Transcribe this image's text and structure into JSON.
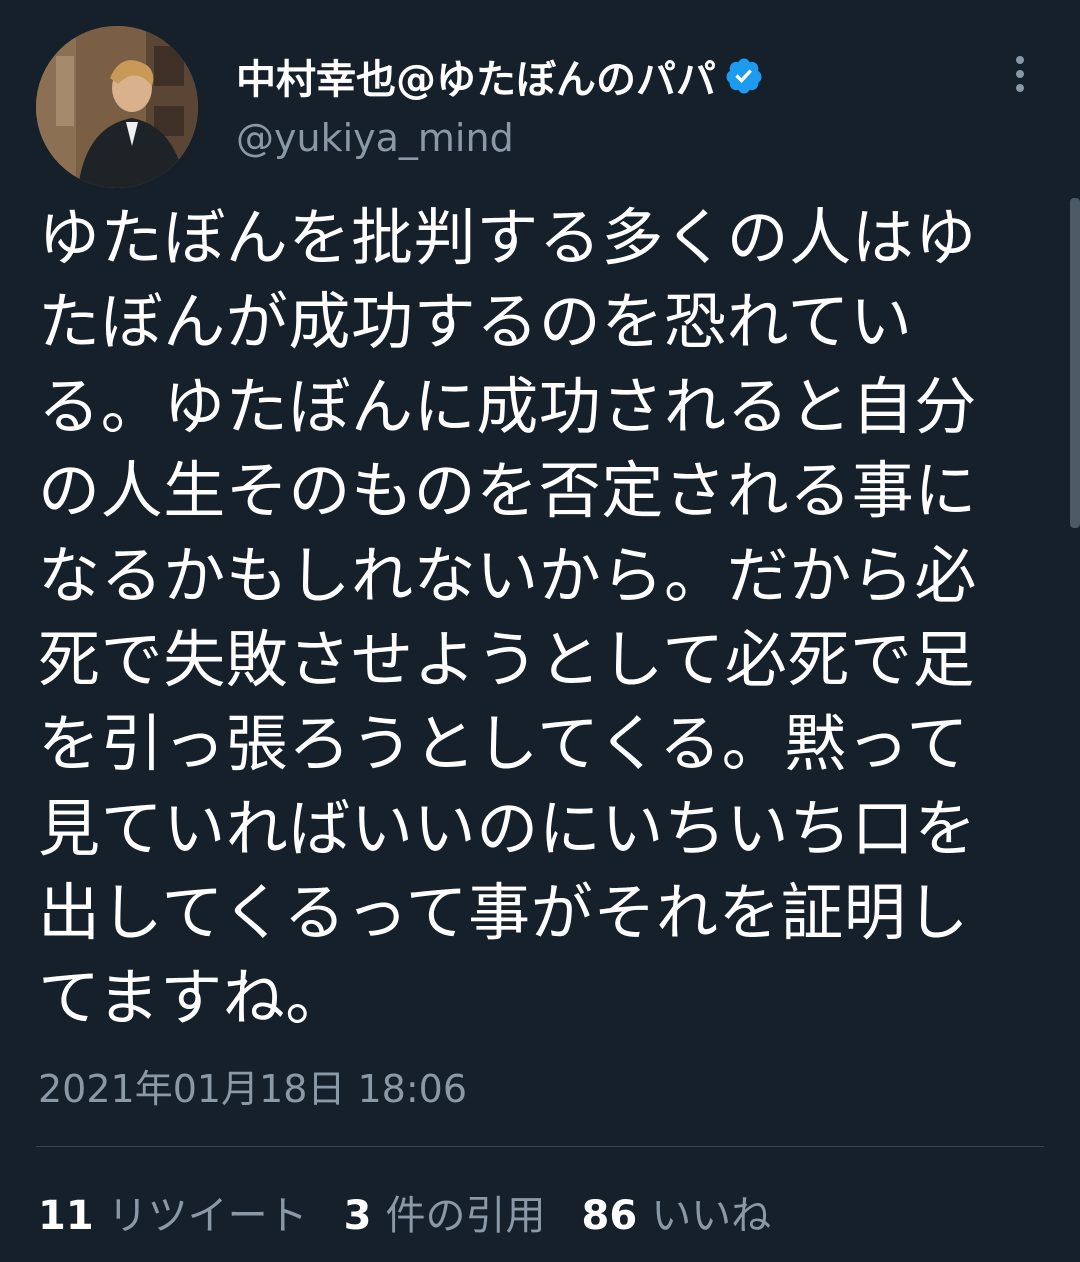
{
  "user": {
    "display_name": "中村幸也@ゆたぼんのパパ",
    "handle": "@yukiya_mind",
    "verified": true,
    "avatar_icon": "avatar-photo"
  },
  "tweet": {
    "lines": [
      "ゆたぼんを批判する多くの人はゆ",
      "たぼんが成功するのを恐れてい",
      "る。ゆたぼんに成功されると自分",
      "の人生そのものを否定される事に",
      "なるかもしれないから。だから必",
      "死で失敗させようとして必死で足",
      "を引っ張ろうとしてくる。黙って",
      "見ていればいいのにいちいち口を",
      "出してくるって事がそれを証明し",
      "てますね。"
    ],
    "timestamp": "2021年01月18日 18:06"
  },
  "stats": {
    "retweets_count": "11",
    "retweets_label": "リツイート",
    "quotes_count": "3",
    "quotes_label": "件の引用",
    "likes_count": "86",
    "likes_label": "いいね"
  },
  "icons": {
    "verified": "verified-badge-icon",
    "more": "more-vertical-icon"
  },
  "colors": {
    "background": "#15202b",
    "text_primary": "#ffffff",
    "text_secondary": "#8b98a5",
    "verified_blue": "#1d9bf0",
    "divider": "#38444d"
  }
}
